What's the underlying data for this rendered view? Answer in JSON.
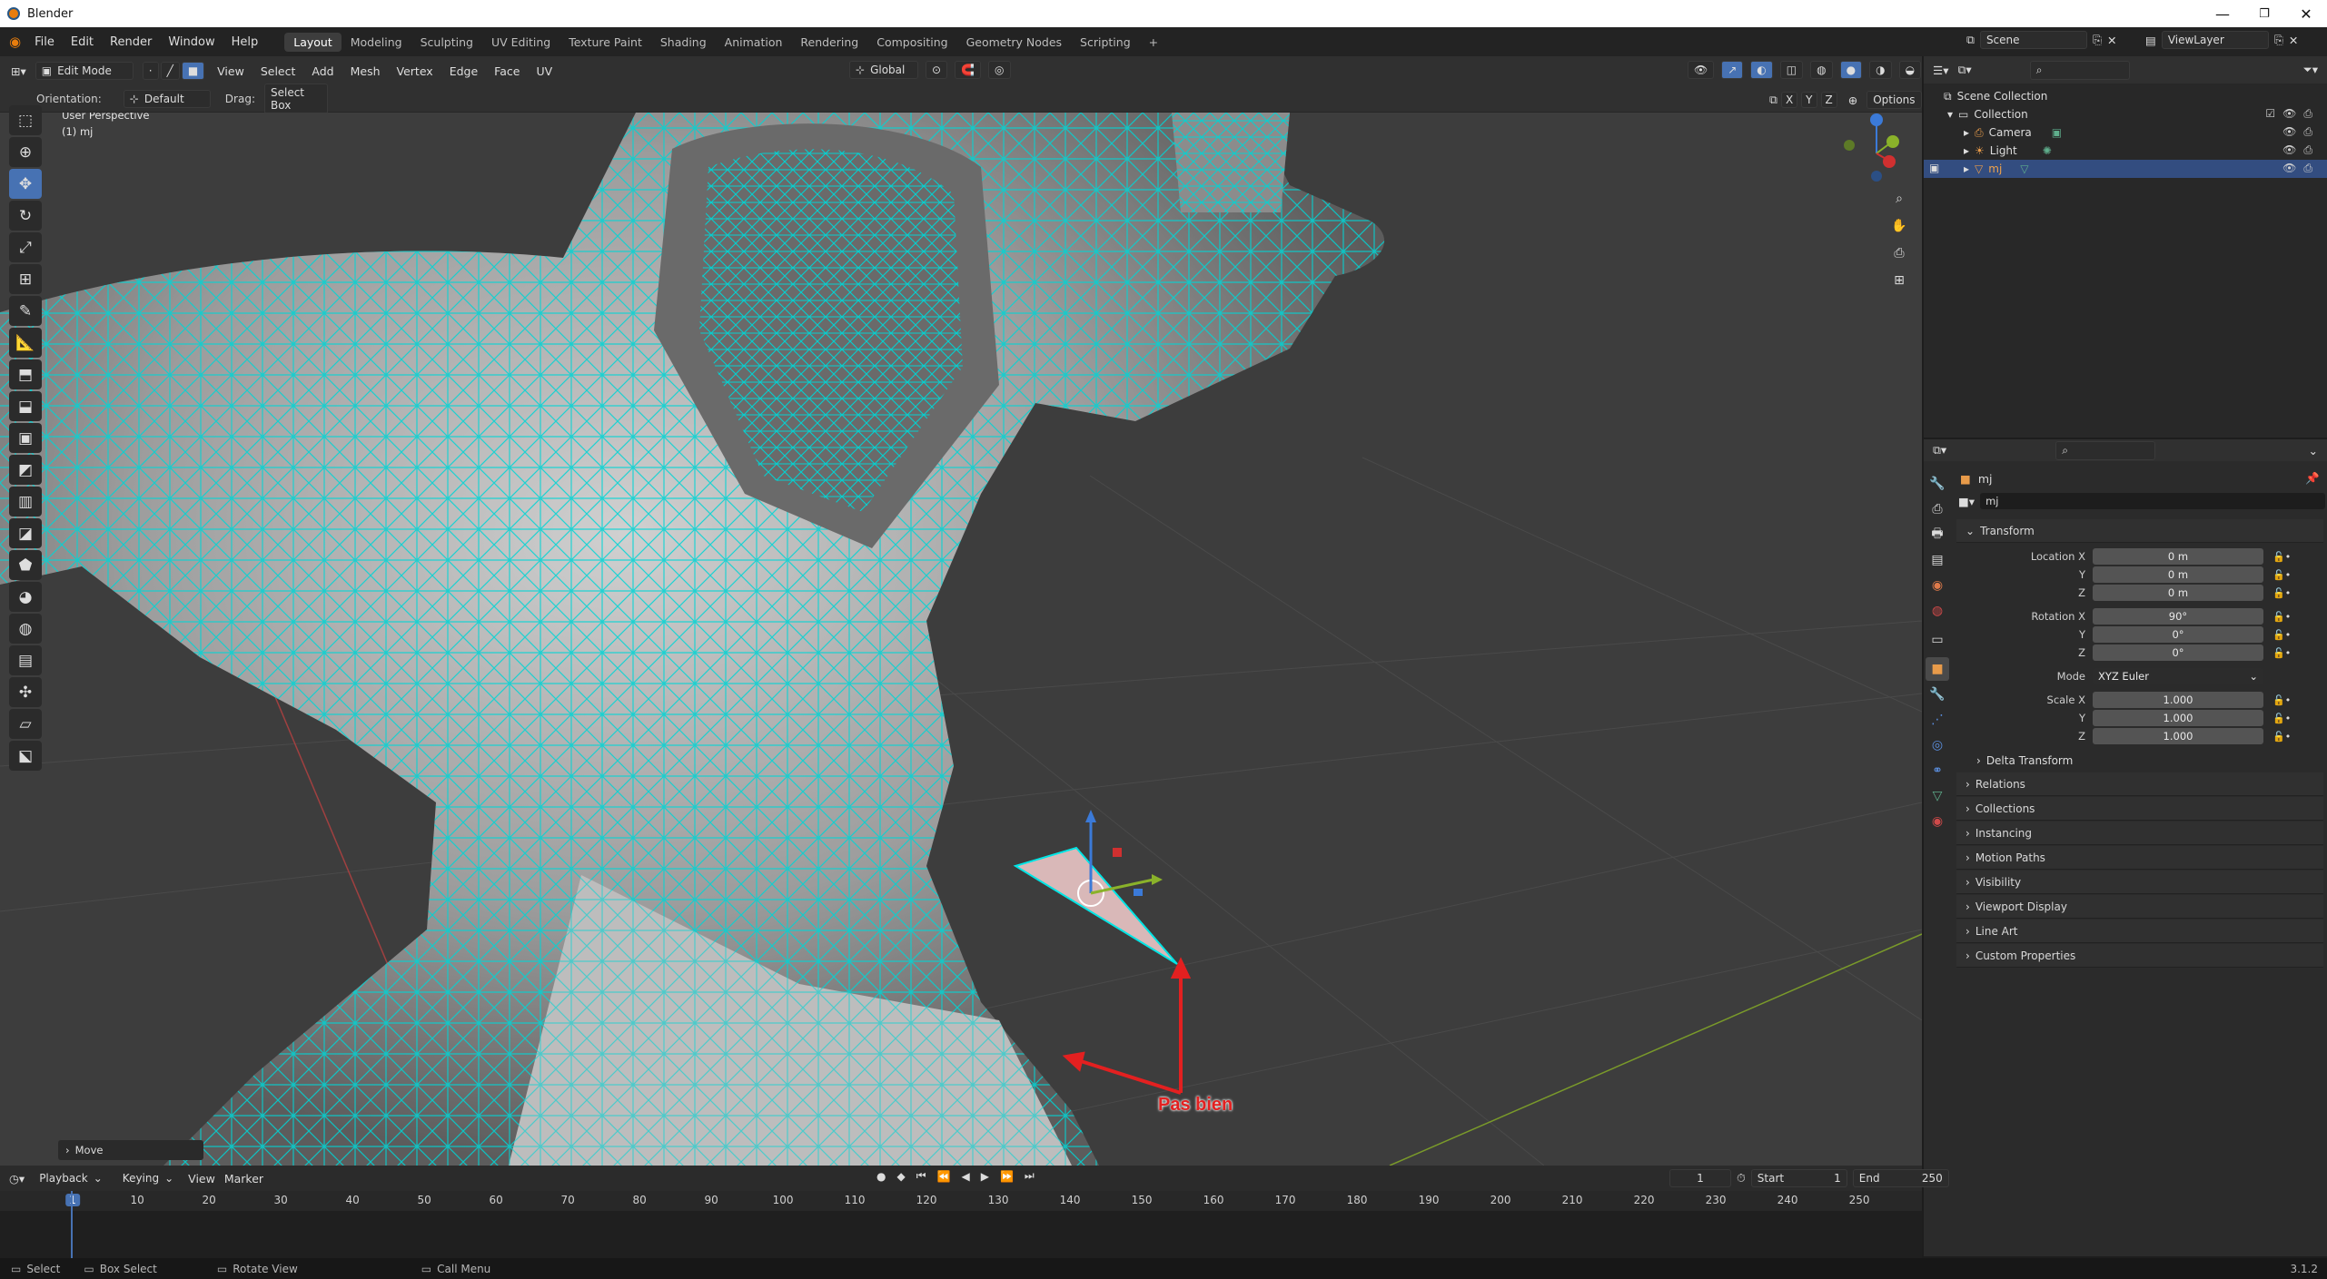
{
  "window": {
    "title": "Blender",
    "controls": [
      "—",
      "❐",
      "✕"
    ]
  },
  "menus": [
    "File",
    "Edit",
    "Render",
    "Window",
    "Help"
  ],
  "workspaces": [
    "Layout",
    "Modeling",
    "Sculpting",
    "UV Editing",
    "Texture Paint",
    "Shading",
    "Animation",
    "Rendering",
    "Compositing",
    "Geometry Nodes",
    "Scripting"
  ],
  "active_workspace": "Layout",
  "scene": {
    "name": "Scene",
    "view_layer": "ViewLayer"
  },
  "viewport_header": {
    "mode": "Edit Mode",
    "menus": [
      "View",
      "Select",
      "Add",
      "Mesh",
      "Vertex",
      "Edge",
      "Face",
      "UV"
    ],
    "transform_orientation": "Global",
    "orientation_label": "Orientation:",
    "orientation_value": "Default",
    "drag_label": "Drag:",
    "drag_value": "Select Box",
    "axes": [
      "X",
      "Y",
      "Z"
    ],
    "options": "Options"
  },
  "viewport": {
    "perspective": "User Perspective",
    "object": "(1) mj",
    "annotation": "Pas bien",
    "operator_panel": "Move"
  },
  "outliner": {
    "root": "Scene Collection",
    "collection": "Collection",
    "items": [
      "Camera",
      "Light",
      "mj"
    ]
  },
  "properties": {
    "object_name": "mj",
    "data_name": "mj",
    "transform_title": "Transform",
    "location": {
      "label": "Location X",
      "x": "0 m",
      "y": "0 m",
      "z": "0 m"
    },
    "rotation": {
      "label": "Rotation X",
      "x": "90°",
      "y": "0°",
      "z": "0°"
    },
    "mode_label": "Mode",
    "mode_value": "XYZ Euler",
    "scale": {
      "label": "Scale X",
      "x": "1.000",
      "y": "1.000",
      "z": "1.000"
    },
    "axis_y": "Y",
    "axis_z": "Z",
    "delta": "Delta Transform",
    "panels": [
      "Relations",
      "Collections",
      "Instancing",
      "Motion Paths",
      "Visibility",
      "Viewport Display",
      "Line Art",
      "Custom Properties"
    ]
  },
  "timeline": {
    "menus": [
      "Playback",
      "Keying",
      "View",
      "Marker"
    ],
    "current_frame": "1",
    "start_label": "Start",
    "start": "1",
    "end_label": "End",
    "end": "250",
    "ticks": [
      "1",
      "10",
      "20",
      "30",
      "40",
      "50",
      "60",
      "70",
      "80",
      "90",
      "100",
      "110",
      "120",
      "130",
      "140",
      "150",
      "160",
      "170",
      "180",
      "190",
      "200",
      "210",
      "220",
      "230",
      "240",
      "250"
    ]
  },
  "statusbar": {
    "items": [
      "Select",
      "Box Select",
      "Rotate View",
      "Call Menu"
    ],
    "version": "3.1.2"
  },
  "colors": {
    "wire": "#00d5d5",
    "accent": "#4772b3",
    "annotation": "#e32020",
    "axis_x": "#b04040",
    "axis_y": "#7a9a2a"
  }
}
